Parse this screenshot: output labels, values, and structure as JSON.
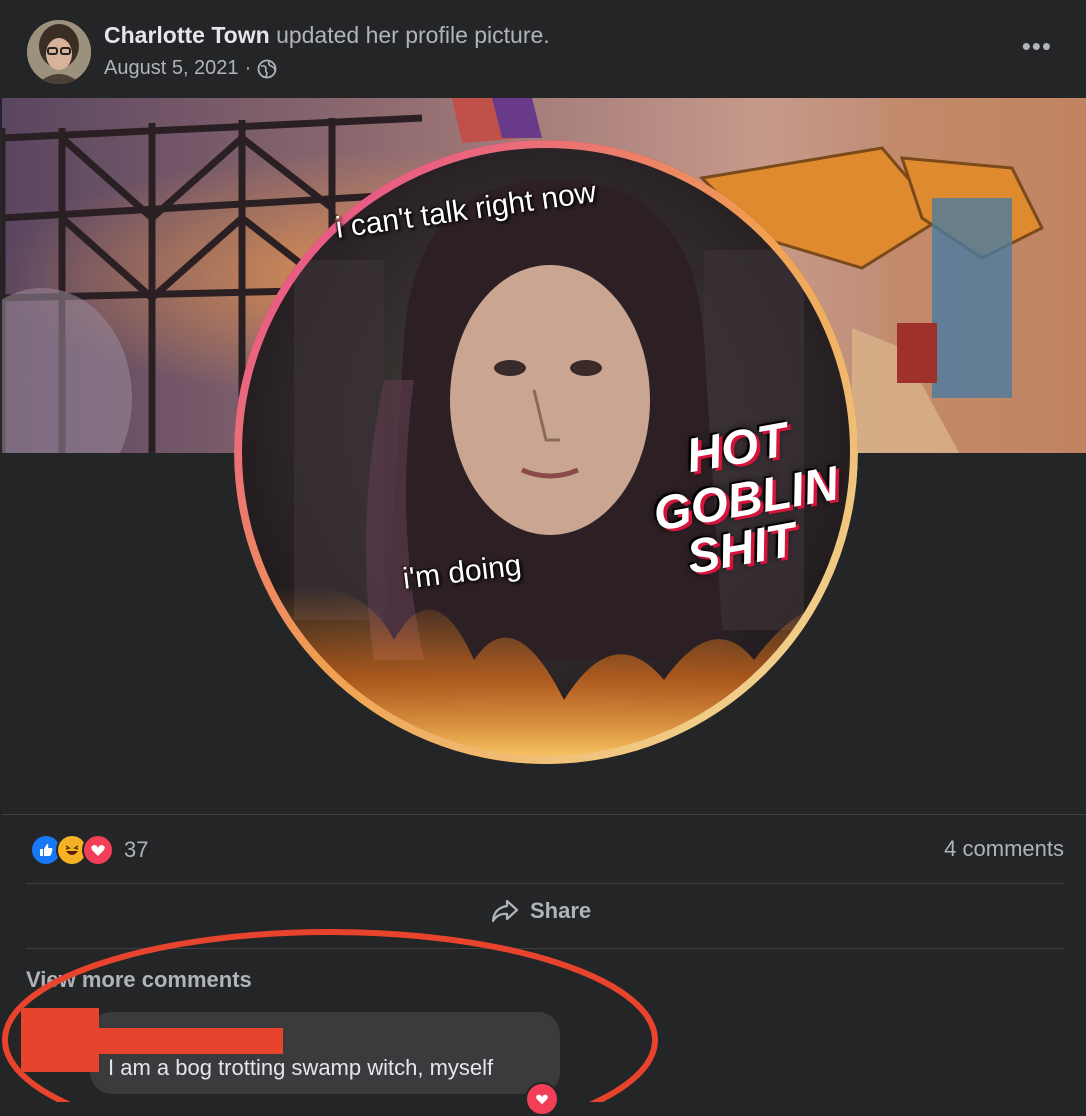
{
  "post": {
    "author": "Charlotte Town",
    "action": "updated her profile picture.",
    "date": "August 5, 2021",
    "separator": "·",
    "privacy_icon": "globe-icon",
    "more_label": "•••"
  },
  "photo": {
    "top_caption": "i can't talk right now",
    "bottom_caption": "i'm doing",
    "stylized_line1": "HOT",
    "stylized_line2": "GOBLIN",
    "stylized_line3": "SHIT"
  },
  "stats": {
    "reaction_icons": [
      "like-icon",
      "haha-icon",
      "love-icon"
    ],
    "reaction_count": "37",
    "comments_count": "4 comments"
  },
  "actions": {
    "share_label": "Share"
  },
  "comments": {
    "view_more_label": "View more comments",
    "items": [
      {
        "text": "I am a bog trotting swamp witch, myself",
        "reaction_icon": "love-icon"
      }
    ]
  },
  "colors": {
    "background": "#242526",
    "secondary_text": "#b0b3b8",
    "primary_text": "#e4e6eb",
    "comment_bubble": "#3a3b3c",
    "annotation_red": "#e8442d",
    "like_blue": "#1877f2",
    "love_red": "#f33e58",
    "haha_yellow": "#f7b125"
  }
}
